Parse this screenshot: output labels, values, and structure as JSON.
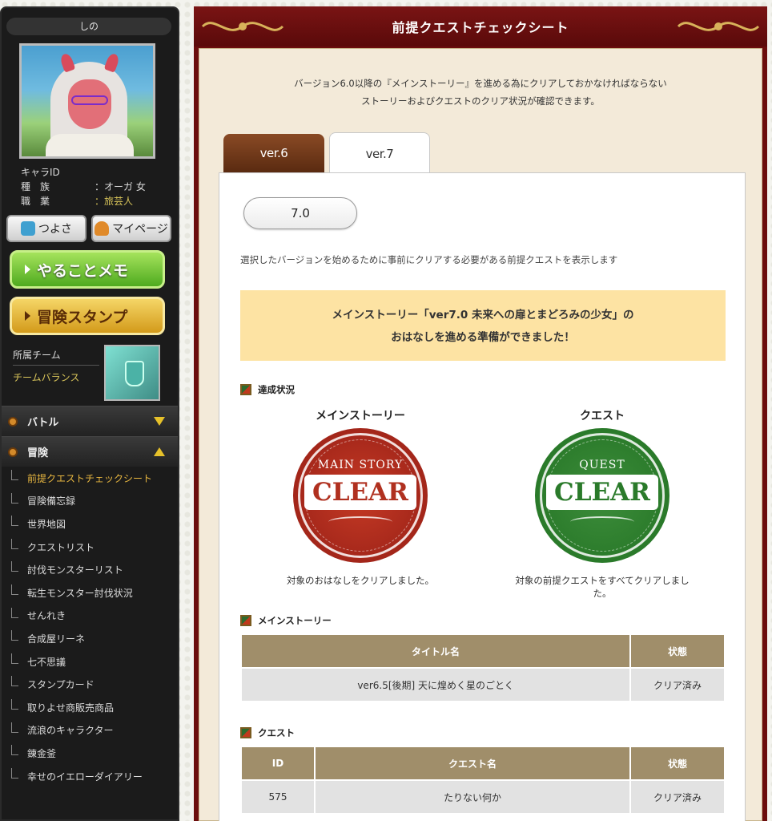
{
  "sidebar": {
    "char_name": "しの",
    "info": [
      {
        "key": "キャラID",
        "value": ""
      },
      {
        "key": "種　族",
        "value": "：オーガ 女"
      },
      {
        "key": "職　業",
        "value": "：旅芸人"
      }
    ],
    "buttons": {
      "strength": "つよさ",
      "mypage": "マイページ"
    },
    "big_buttons": {
      "memo": "やることメモ",
      "stamp": "冒険スタンプ"
    },
    "team": {
      "label": "所属チーム",
      "balance": "チームバランス"
    },
    "nav": {
      "battle": "バトル",
      "adventure": "冒険",
      "items": [
        "前提クエストチェックシート",
        "冒険備忘録",
        "世界地図",
        "クエストリスト",
        "討伐モンスターリスト",
        "転生モンスター討伐状況",
        "せんれき",
        "合成屋リーネ",
        "七不思議",
        "スタンプカード",
        "取りよせ商販売商品",
        "流浪のキャラクター",
        "錬金釜",
        "幸せのイエローダイアリー"
      ]
    }
  },
  "main": {
    "title": "前提クエストチェックシート",
    "intro_line1": "バージョン6.0以降の『メインストーリー』を進める為にクリアしておかなければならない",
    "intro_line2": "ストーリーおよびクエストのクリア状況が確認できます。",
    "tabs": [
      "ver.6",
      "ver.7"
    ],
    "version_select": "7.0",
    "description": "選択したバージョンを始めるために事前にクリアする必要がある前提クエストを表示します",
    "banner_line1": "メインストーリー「ver7.0 未来への扉とまどろみの少女」の",
    "banner_line2": "おはなしを進める準備ができました！",
    "achievement_heading": "達成状況",
    "badges": [
      {
        "label": "メインストーリー",
        "top": "MAIN STORY",
        "ribbon": "CLEAR",
        "caption": "対象のおはなしをクリアしました。"
      },
      {
        "label": "クエスト",
        "top": "QUEST",
        "ribbon": "CLEAR",
        "caption": "対象の前提クエストをすべてクリアしました。"
      }
    ],
    "main_story_heading": "メインストーリー",
    "main_story_table": {
      "headers": [
        "タイトル名",
        "状態"
      ],
      "rows": [
        [
          "ver6.5[後期] 天に煌めく星のごとく",
          "クリア済み"
        ]
      ]
    },
    "quest_heading": "クエスト",
    "quest_table": {
      "headers": [
        "ID",
        "クエスト名",
        "状態"
      ],
      "rows": [
        [
          "575",
          "たりない何か",
          "クリア済み"
        ]
      ]
    }
  },
  "colors": {
    "header_red": "#6b0d0d",
    "table_header": "#a08e6a",
    "banner": "#fde3a3",
    "clear_red": "#a3261a",
    "clear_green": "#2a7a2a"
  }
}
